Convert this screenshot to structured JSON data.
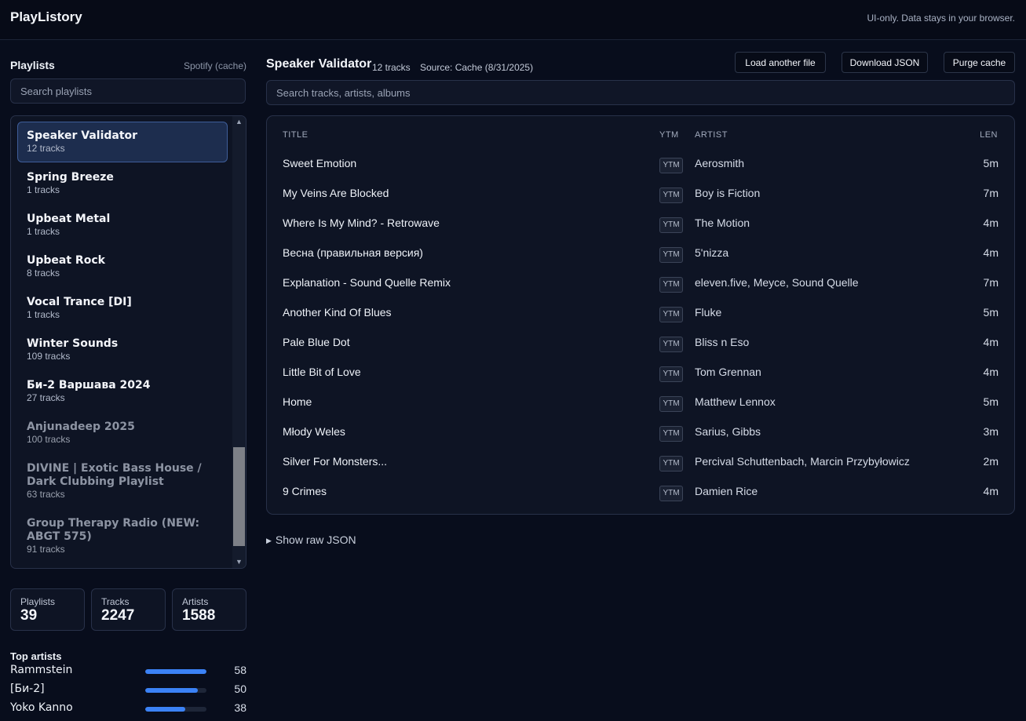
{
  "header": {
    "brand": "PlayListory",
    "note": "UI-only. Data stays in your browser."
  },
  "sidebar": {
    "title": "Playlists",
    "source": "Spotify (cache)",
    "search_placeholder": "Search playlists",
    "playlists": [
      {
        "name": "Speaker Validator",
        "count": "12 tracks",
        "active": true
      },
      {
        "name": "Spring Breeze",
        "count": "1 tracks"
      },
      {
        "name": "Upbeat Metal",
        "count": "1 tracks"
      },
      {
        "name": "Upbeat Rock",
        "count": "8 tracks"
      },
      {
        "name": "Vocal Trance [DI]",
        "count": "1 tracks"
      },
      {
        "name": "Winter Sounds",
        "count": "109 tracks"
      },
      {
        "name": "Би-2 Варшава 2024",
        "count": "27 tracks"
      },
      {
        "name": "Anjunadeep 2025",
        "count": "100 tracks",
        "dim": true
      },
      {
        "name": "DIVINE | Exotic Bass House / Dark Clubbing Playlist",
        "count": "63 tracks",
        "dim": true
      },
      {
        "name": "Group Therapy Radio (NEW: ABGT 575)",
        "count": "91 tracks",
        "dim": true
      }
    ],
    "stats": [
      {
        "label": "Playlists",
        "value": "39"
      },
      {
        "label": "Tracks",
        "value": "2247"
      },
      {
        "label": "Artists",
        "value": "1588"
      }
    ],
    "top_artists_title": "Top artists",
    "top_artists": [
      {
        "name": "Rammstein",
        "count": "58",
        "fraction": 1.0
      },
      {
        "name": "[Би-2]",
        "count": "50",
        "fraction": 0.86
      },
      {
        "name": "Yoko Kanno",
        "count": "38",
        "fraction": 0.66
      }
    ]
  },
  "main": {
    "title": "Speaker Validator",
    "tracks_meta": "12 tracks",
    "source_meta": "Source: Cache (8/31/2025)",
    "buttons": {
      "load": "Load another file",
      "download": "Download JSON",
      "purge": "Purge cache"
    },
    "search_placeholder": "Search tracks, artists, albums",
    "columns": {
      "title": "TITLE",
      "ytm": "YTM",
      "artist": "ARTIST",
      "len": "LEN"
    },
    "ytm_label": "YTM",
    "tracks": [
      {
        "title": "Sweet Emotion",
        "artist": "Aerosmith",
        "len": "5m"
      },
      {
        "title": "My Veins Are Blocked",
        "artist": "Boy is Fiction",
        "len": "7m"
      },
      {
        "title": "Where Is My Mind? - Retrowave",
        "artist": "The Motion",
        "len": "4m"
      },
      {
        "title": "Весна (правильная версия)",
        "artist": "5'nizza",
        "len": "4m"
      },
      {
        "title": "Explanation - Sound Quelle Remix",
        "artist": "eleven.five, Meyce, Sound Quelle",
        "len": "7m"
      },
      {
        "title": "Another Kind Of Blues",
        "artist": "Fluke",
        "len": "5m"
      },
      {
        "title": "Pale Blue Dot",
        "artist": "Bliss n Eso",
        "len": "4m"
      },
      {
        "title": "Little Bit of Love",
        "artist": "Tom Grennan",
        "len": "4m"
      },
      {
        "title": "Home",
        "artist": "Matthew Lennox",
        "len": "5m"
      },
      {
        "title": "Młody Weles",
        "artist": "Sarius, Gibbs",
        "len": "3m"
      },
      {
        "title": "Silver For Monsters...",
        "artist": "Percival Schuttenbach, Marcin Przybyłowicz",
        "len": "2m"
      },
      {
        "title": "9 Crimes",
        "artist": "Damien Rice",
        "len": "4m"
      }
    ],
    "raw_json_toggle": "Show raw JSON"
  }
}
